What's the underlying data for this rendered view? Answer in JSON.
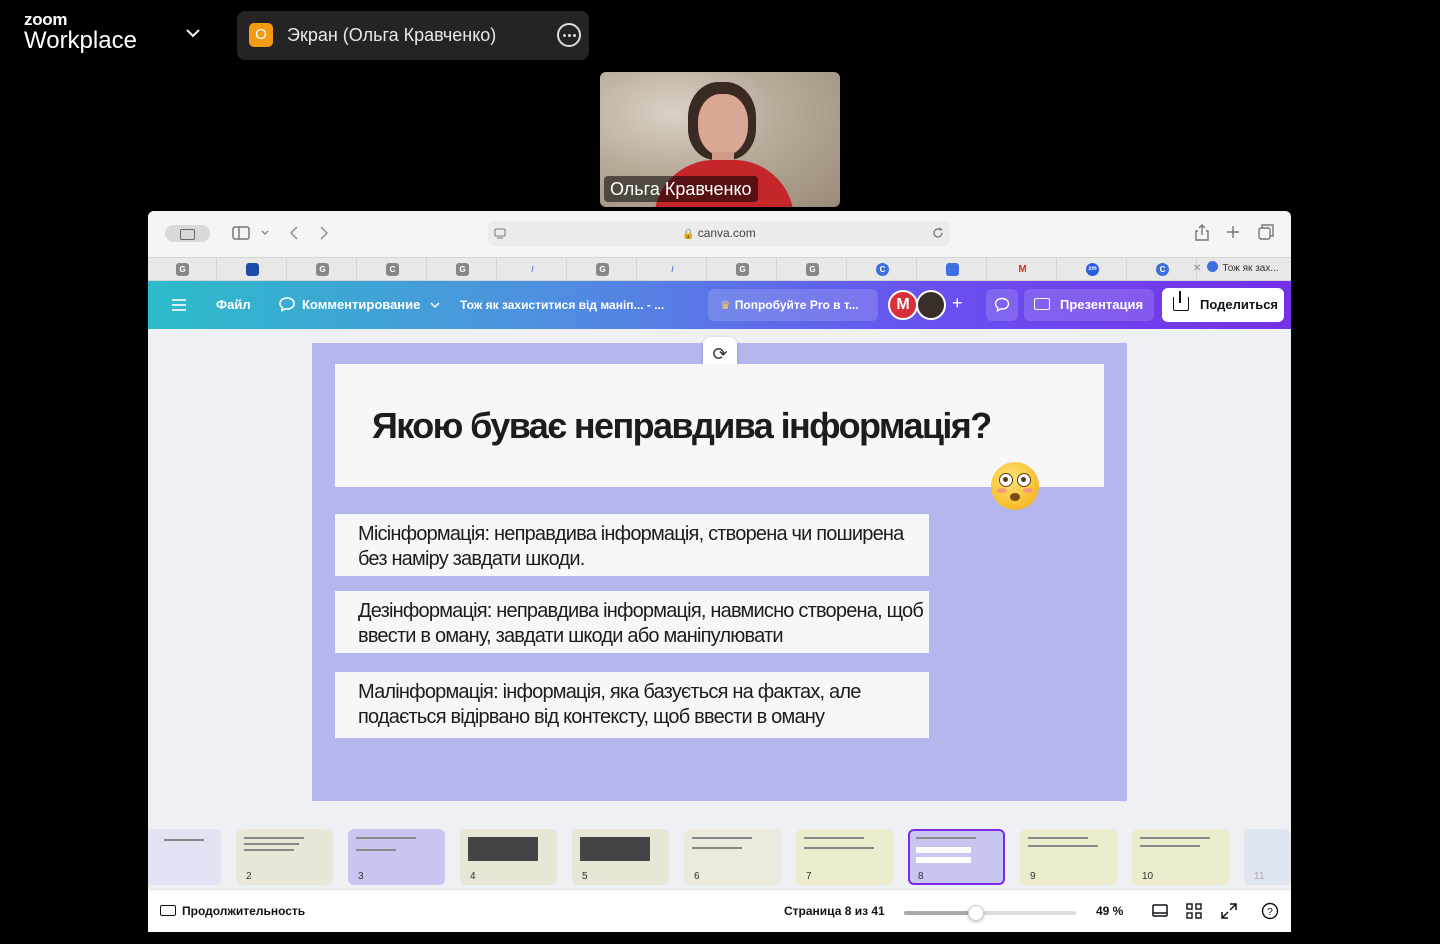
{
  "zoom": {
    "brand_small": "zoom",
    "brand_big": "Workplace",
    "share_initial": "О",
    "share_label": "Экран (Ольга Кравченко)",
    "participant_name": "Ольга Кравченко"
  },
  "browser": {
    "url": "canva.com",
    "active_tab": "Тож як зах...",
    "tab_favicons": [
      "G",
      "flag",
      "G",
      "C",
      "G",
      "/",
      "G",
      "/",
      "G",
      "G",
      "C",
      "doc",
      "M",
      "zm",
      "C"
    ]
  },
  "canva": {
    "file": "Файл",
    "commenting": "Комментирование",
    "doc_title": "Тож як захиститися від маніп... - ...",
    "try_pro": "Попробуйте Pro в т...",
    "avatar_initial": "M",
    "present": "Презентация",
    "share": "Поделиться"
  },
  "slide": {
    "title": "Якою буває неправдива інформація?",
    "definitions": [
      "Місінформація: неправдива інформація, створена чи поширена без наміру завдати шкоди.",
      "Дезінформація: неправдива інформація, навмисно створена, щоб ввести в оману, завдати шкоди або маніпулювати",
      "Малінформація: інформація, яка базується на фактах, але подається відірвано від контексту, щоб ввести в оману"
    ]
  },
  "thumbnails": [
    "",
    "2",
    "3",
    "4",
    "5",
    "6",
    "7",
    "8",
    "9",
    "10",
    "11"
  ],
  "selected_page": 8,
  "footer": {
    "duration": "Продолжительность",
    "page_indicator": "Страница 8 из 41",
    "zoom_level": "49 %",
    "zoom_fraction": 0.42
  },
  "colors": {
    "slide_bg": "#b6b6ee",
    "canva_gradient_start": "#2cbcc9",
    "canva_gradient_end": "#7431e8",
    "zoom_share_accent": "#f49b16",
    "selected_thumb": "#7d2ae8"
  }
}
